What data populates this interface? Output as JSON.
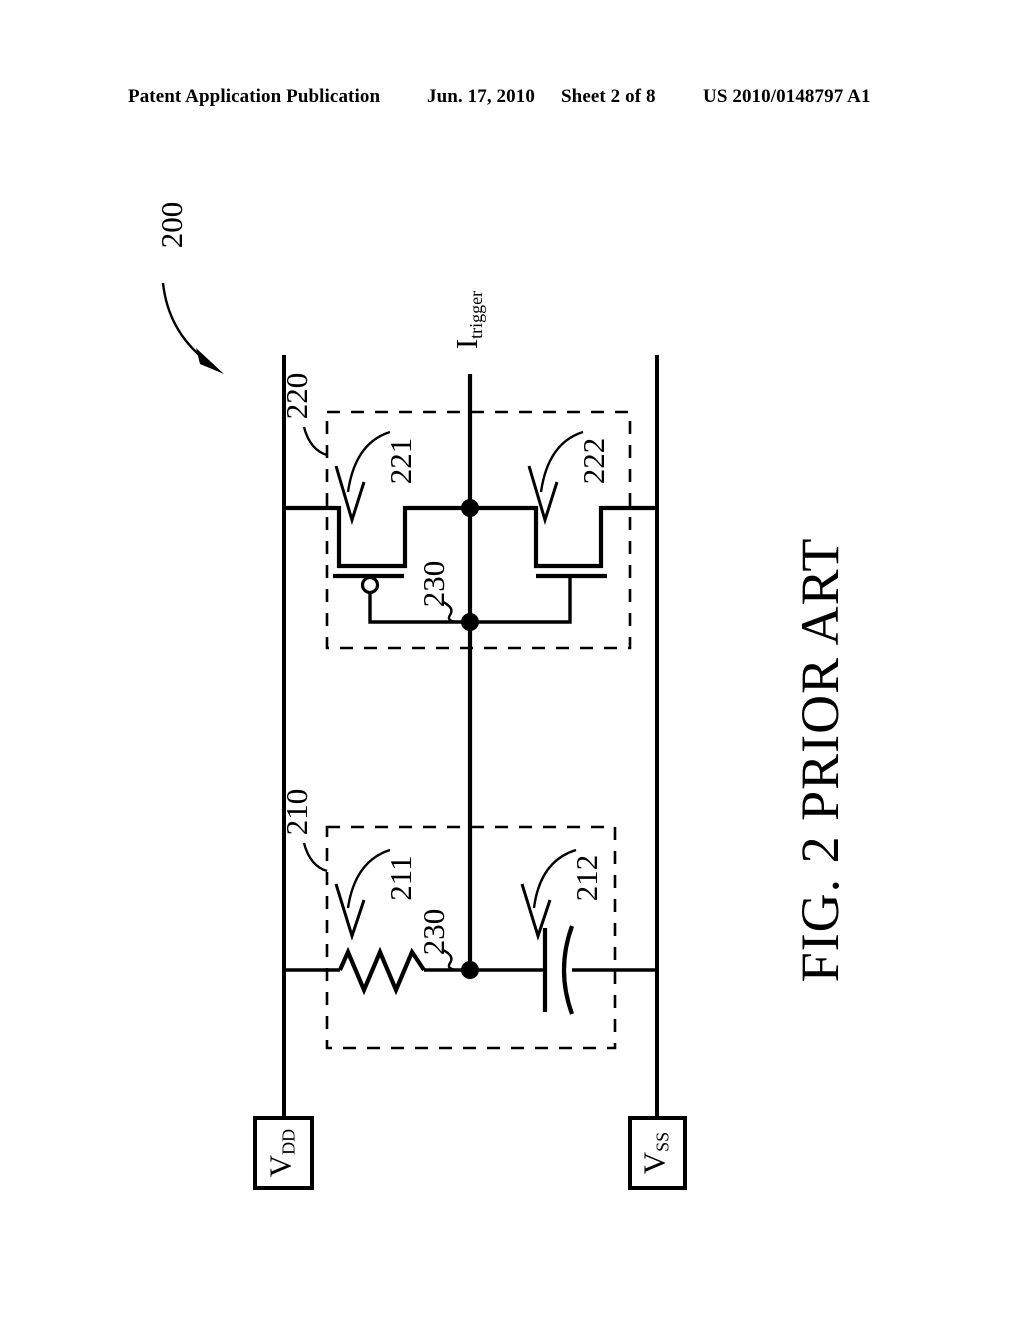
{
  "header": {
    "publication": "Patent Application Publication",
    "date": "Jun. 17, 2010",
    "sheet": "Sheet 2 of 8",
    "patent_number": "US 2010/0148797 A1"
  },
  "figure": {
    "caption": "FIG. 2 PRIOR ART",
    "circuit_label": "200"
  },
  "labels": {
    "vdd_main": "V",
    "vdd_sub": "DD",
    "vss_main": "V",
    "vss_sub": "SS",
    "itrigger_main": "I",
    "itrigger_sub": "trigger",
    "block_rc": "210",
    "resistor": "211",
    "capacitor": "212",
    "block_inverter": "220",
    "pmos": "221",
    "nmos": "222",
    "node_a": "230",
    "node_b": "230"
  },
  "colors": {
    "ink": "#000000",
    "paper": "#ffffff"
  },
  "chart_data": {
    "type": "diagram",
    "title": "FIG. 2 PRIOR ART",
    "description": "Prior-art ESD power-clamp trigger circuit 200",
    "nodes": [
      {
        "id": "VDD",
        "label": "V_DD",
        "kind": "supply-rail"
      },
      {
        "id": "VSS",
        "label": "V_SS",
        "kind": "supply-rail"
      },
      {
        "id": "230",
        "label": "230",
        "kind": "internal-node"
      },
      {
        "id": "Itrigger",
        "label": "I_trigger",
        "kind": "output-current"
      }
    ],
    "blocks": [
      {
        "id": "210",
        "label": "210",
        "kind": "RC-timer",
        "contains": [
          "211",
          "212"
        ]
      },
      {
        "id": "220",
        "label": "220",
        "kind": "inverter",
        "contains": [
          "221",
          "222"
        ]
      }
    ],
    "components": [
      {
        "id": "211",
        "type": "resistor",
        "between": [
          "VDD",
          "230"
        ]
      },
      {
        "id": "212",
        "type": "capacitor",
        "between": [
          "230",
          "VSS"
        ]
      },
      {
        "id": "221",
        "type": "pmos-transistor",
        "source": "VDD",
        "drain": "Itrigger",
        "gate": "230"
      },
      {
        "id": "222",
        "type": "nmos-transistor",
        "source": "VSS",
        "drain": "Itrigger",
        "gate": "230"
      }
    ]
  }
}
